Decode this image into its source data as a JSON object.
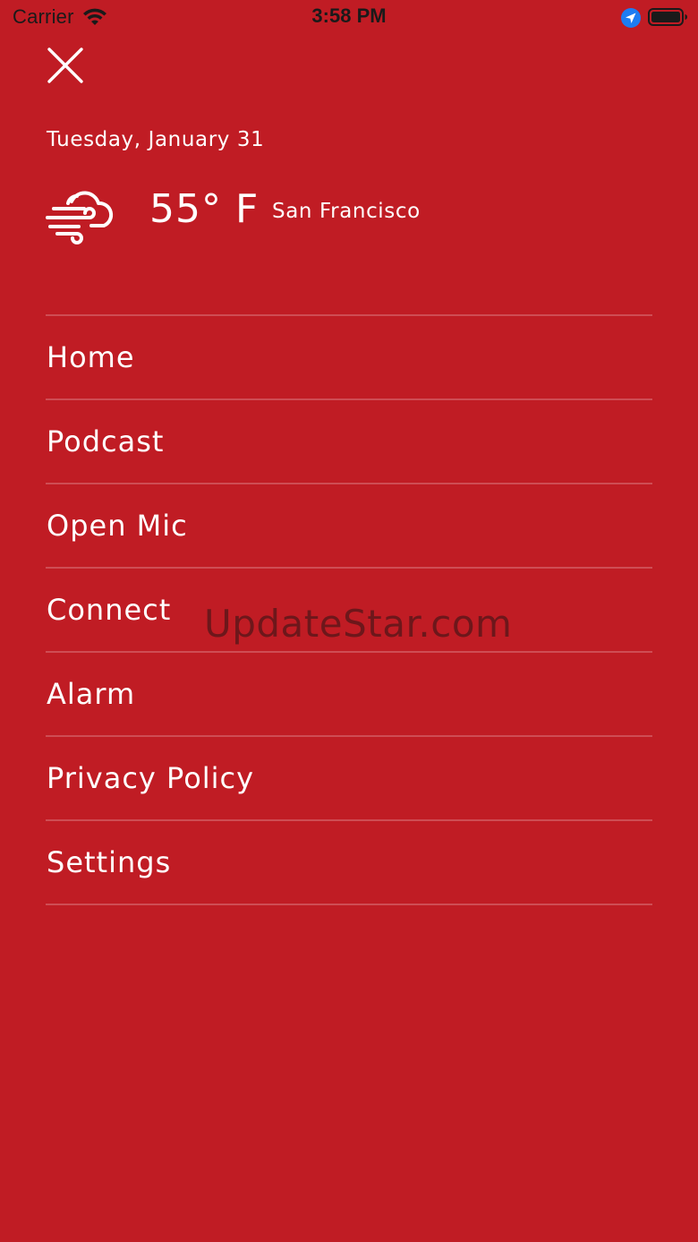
{
  "status_bar": {
    "carrier": "Carrier",
    "time": "3:58 PM",
    "wifi_icon": "wifi-icon",
    "location_icon": "location-arrow-icon",
    "battery_icon": "battery-icon",
    "location_color": "#1e7cf2",
    "text_color": "#1a1a1a"
  },
  "header": {
    "close_icon": "close-icon",
    "date": "Tuesday, January 31"
  },
  "weather": {
    "icon": "windy-cloud-icon",
    "temperature": "55° F",
    "city": "San Francisco"
  },
  "menu": {
    "items": [
      {
        "label": "Home"
      },
      {
        "label": "Podcast"
      },
      {
        "label": "Open Mic"
      },
      {
        "label": "Connect"
      },
      {
        "label": "Alarm"
      },
      {
        "label": "Privacy Policy"
      },
      {
        "label": "Settings"
      }
    ]
  },
  "watermark": "UpdateStar.com",
  "colors": {
    "background": "#c01c24",
    "text": "#ffffff",
    "divider": "rgba(255,255,255,0.22)"
  }
}
